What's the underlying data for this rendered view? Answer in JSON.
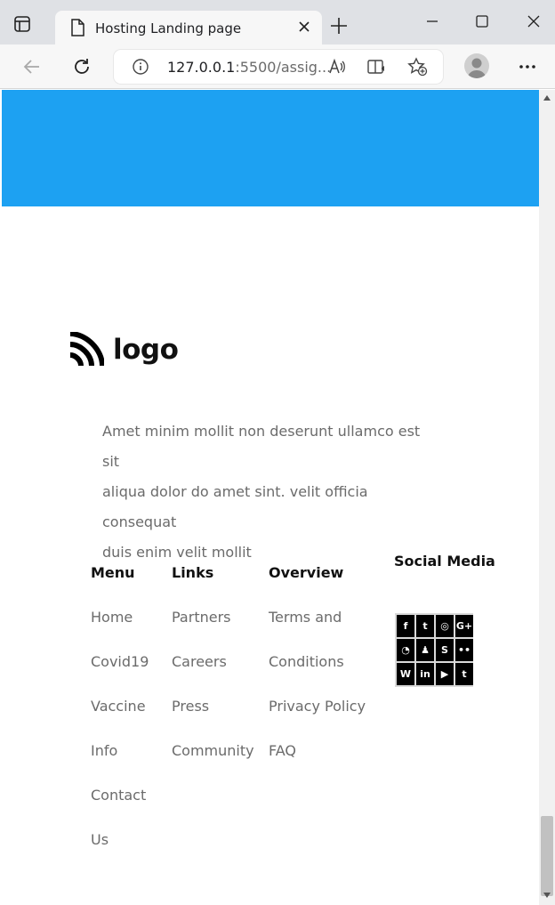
{
  "browser": {
    "tab_title": "Hosting Landing page",
    "url_host": "127.0.0.1",
    "url_rest": ":5500/assig..."
  },
  "page": {
    "hero_color": "#1da1f2",
    "logo_text": "logo",
    "about_lines": [
      "Amet minim mollit non deserunt ullamco est sit",
      "aliqua dolor do amet sint. velit officia consequat",
      "duis enim velit mollit"
    ],
    "footer": {
      "menu": {
        "title": "Menu",
        "items": [
          "Home",
          "Covid19",
          "Vaccine",
          "Info",
          "Contact",
          "Us"
        ]
      },
      "links": {
        "title": "Links",
        "items": [
          "Partners",
          "Careers",
          "Press",
          "Community"
        ]
      },
      "overview": {
        "title": "Overview",
        "items": [
          "Terms and",
          "Conditions",
          "Privacy Policy",
          "FAQ"
        ]
      },
      "social": {
        "title": "Social Media",
        "icons": [
          {
            "name": "facebook-icon",
            "glyph": "f"
          },
          {
            "name": "twitter-icon",
            "glyph": "t"
          },
          {
            "name": "instagram-icon",
            "glyph": "◎"
          },
          {
            "name": "google-plus-icon",
            "glyph": "G+"
          },
          {
            "name": "whatsapp-icon",
            "glyph": "◔"
          },
          {
            "name": "snapchat-icon",
            "glyph": "♟"
          },
          {
            "name": "skype-icon",
            "glyph": "S"
          },
          {
            "name": "flickr-icon",
            "glyph": "••"
          },
          {
            "name": "wordpress-icon",
            "glyph": "W"
          },
          {
            "name": "linkedin-icon",
            "glyph": "in"
          },
          {
            "name": "youtube-icon",
            "glyph": "▶"
          },
          {
            "name": "tumblr-icon",
            "glyph": "t"
          }
        ]
      }
    }
  }
}
